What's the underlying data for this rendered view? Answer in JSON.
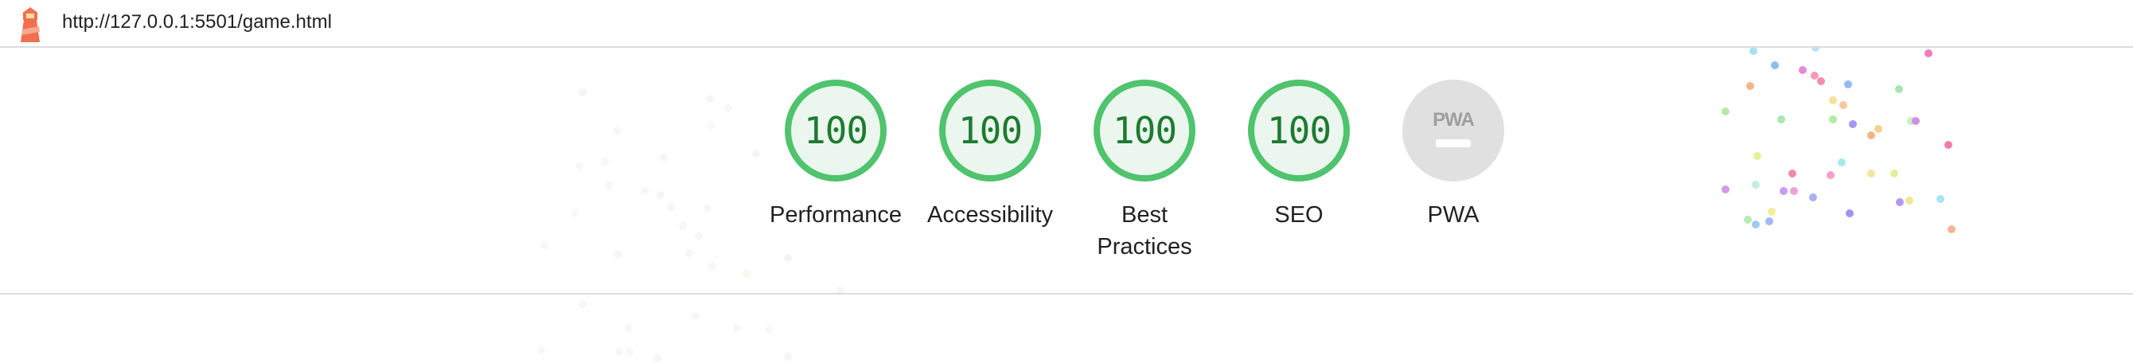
{
  "browser": {
    "url": "http://127.0.0.1:5501/game.html",
    "logo_icon": "lighthouse-icon"
  },
  "gauges": [
    {
      "label": "Performance",
      "score": "100"
    },
    {
      "label": "Accessibility",
      "score": "100"
    },
    {
      "label": "Best Practices",
      "score": "100"
    },
    {
      "label": "SEO",
      "score": "100"
    },
    {
      "label": "PWA",
      "badge": "PWA"
    }
  ],
  "colors": {
    "pass_ring": "#4fc36d",
    "pass_fill": "#ebf7ee",
    "pass_text": "#1e7b30",
    "na_fill": "#e0e0e0"
  }
}
